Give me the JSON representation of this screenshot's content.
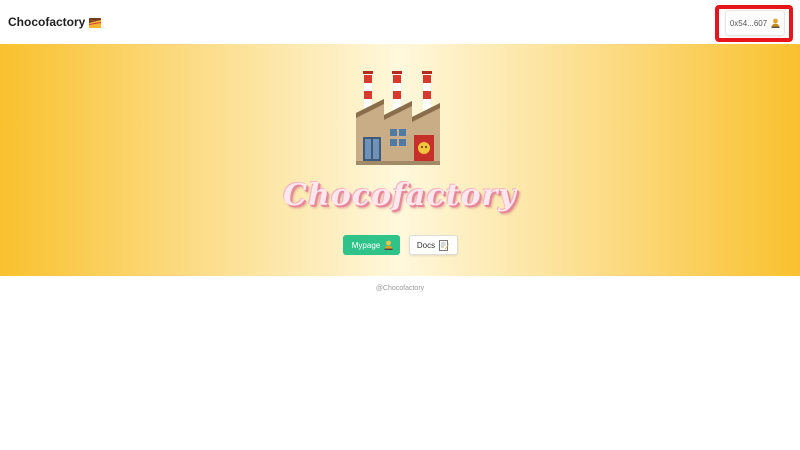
{
  "header": {
    "brand_label": "Chocofactory",
    "brand_icon": "chocolate-bar-icon",
    "wallet_address": "0x54...607",
    "wallet_icon": "person-icon"
  },
  "hero": {
    "image": "factory-icon",
    "title": "Chocofactory",
    "mypage_label": "Mypage",
    "mypage_icon": "person-icon",
    "docs_label": "Docs",
    "docs_icon": "memo-icon"
  },
  "footer": {
    "text": "@Chocofactory"
  },
  "colors": {
    "accent_green": "#2fc389",
    "hero_yellow": "#f9c12d",
    "highlight_red": "#e8141c"
  }
}
